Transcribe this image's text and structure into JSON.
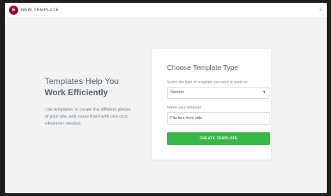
{
  "header": {
    "logo_letter": "E",
    "title": "NEW TEMPLATE",
    "close_icon": "×"
  },
  "intro": {
    "line1": "Templates Help You",
    "line2": "Work Efficiently",
    "description": "Use templates to create the different pieces of your site, and reuse them with one click whenever needed."
  },
  "form": {
    "title": "Choose Template Type",
    "type_label": "Select the type of template you want to work on",
    "type_value": "Section",
    "name_label": "Name your template",
    "name_value": "Flip box front side",
    "create_label": "CREATE TEMPLATE"
  },
  "colors": {
    "brand": "#92003b",
    "button": "#39b54a",
    "background": "#f1f3f5"
  }
}
